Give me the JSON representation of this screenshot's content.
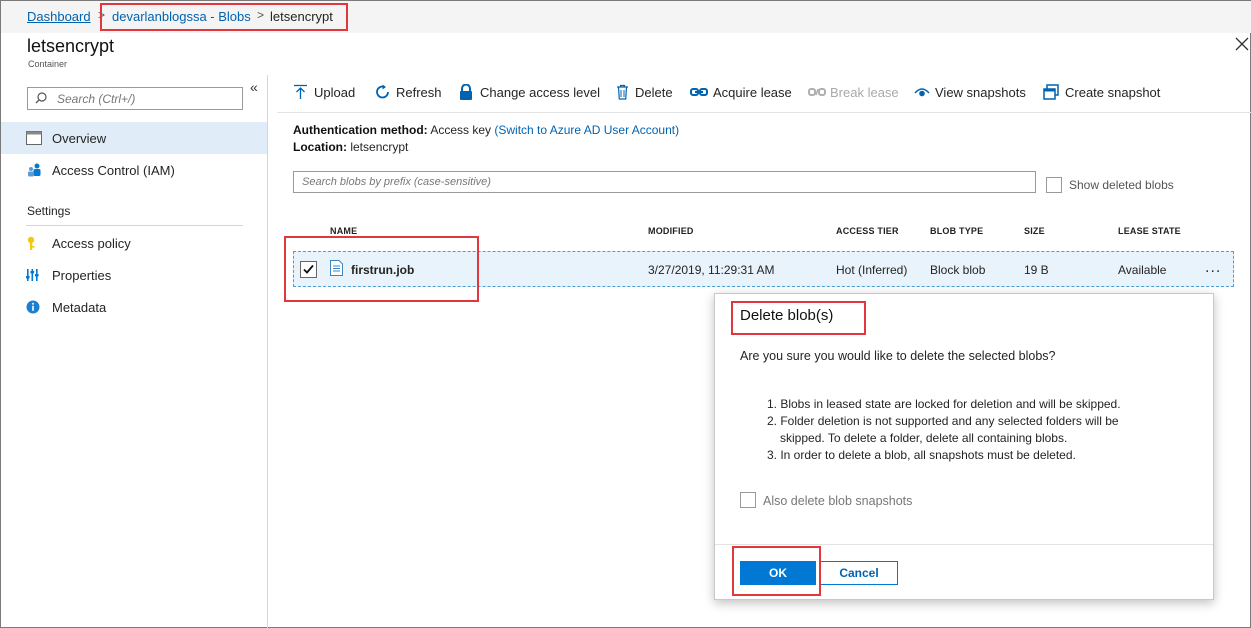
{
  "breadcrumb": {
    "items": [
      "Dashboard",
      "devarlanblogssa - Blobs",
      "letsencrypt"
    ],
    "separator": ">"
  },
  "header": {
    "title": "letsencrypt",
    "subtitle": "Container",
    "close_icon": "close-icon"
  },
  "sidebar": {
    "collapse_icon": "double-chevron-left-icon",
    "search_placeholder": "Search (Ctrl+/)",
    "items": [
      {
        "label": "Overview",
        "icon": "overview-icon",
        "selected": true
      },
      {
        "label": "Access Control (IAM)",
        "icon": "people-icon",
        "selected": false
      }
    ],
    "settings_label": "Settings",
    "settings_items": [
      {
        "label": "Access policy",
        "icon": "key-icon"
      },
      {
        "label": "Properties",
        "icon": "sliders-icon"
      },
      {
        "label": "Metadata",
        "icon": "info-icon"
      }
    ]
  },
  "toolbar": {
    "upload": "Upload",
    "refresh": "Refresh",
    "change_access": "Change access level",
    "delete": "Delete",
    "acquire_lease": "Acquire lease",
    "break_lease": "Break lease",
    "view_snapshots": "View snapshots",
    "create_snapshot": "Create snapshot"
  },
  "info": {
    "auth_label": "Authentication method:",
    "auth_value": "Access key",
    "auth_link": "(Switch to Azure AD User Account)",
    "location_label": "Location:",
    "location_value": "letsencrypt"
  },
  "search": {
    "placeholder": "Search blobs by prefix (case-sensitive)",
    "show_deleted": "Show deleted blobs"
  },
  "table": {
    "headers": [
      "NAME",
      "MODIFIED",
      "ACCESS TIER",
      "BLOB TYPE",
      "SIZE",
      "LEASE STATE"
    ],
    "rows": [
      {
        "checked": true,
        "name": "firstrun.job",
        "modified": "3/27/2019, 11:29:31 AM",
        "tier": "Hot (Inferred)",
        "type": "Block blob",
        "size": "19 B",
        "lease": "Available"
      }
    ],
    "more": "..."
  },
  "dialog": {
    "title": "Delete blob(s)",
    "question": "Are you sure you would like to delete the selected blobs?",
    "notes": [
      "1. Blobs in leased state are locked for deletion and will be skipped.",
      "2. Folder deletion is not supported and any selected folders will be",
      "skipped. To delete a folder, delete all containing blobs.",
      "3. In order to delete a blob, all snapshots must be deleted."
    ],
    "snapshots_label": "Also delete blob snapshots",
    "ok": "OK",
    "cancel": "Cancel"
  },
  "colors": {
    "accent": "#0078d4",
    "link": "#0063b1",
    "annotation": "#e0383e",
    "selected_nav": "#e0edf8"
  }
}
